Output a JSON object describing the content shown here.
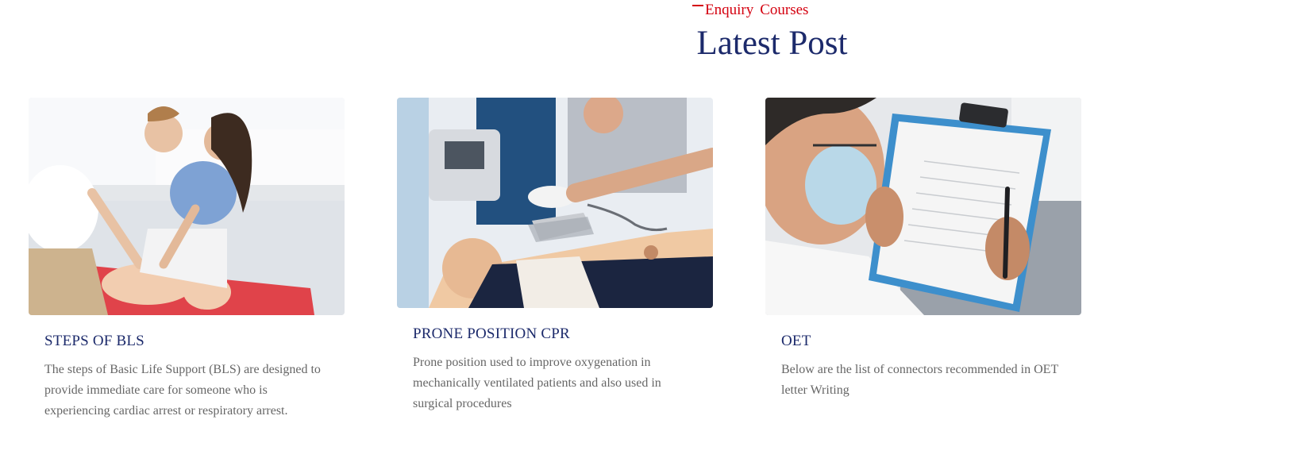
{
  "header": {
    "enquiry_label": "Enquiry",
    "courses_label": "Courses"
  },
  "section": {
    "title": "Latest Post"
  },
  "posts": [
    {
      "image_alt": "Two women practicing chest compressions on a CPR mannequin",
      "title": "STEPS OF BLS",
      "excerpt": "The steps of Basic Life Support (BLS) are designed to provide immediate care for someone who is experiencing cardiac arrest or respiratory arrest."
    },
    {
      "image_alt": "Gloved hand placing defibrillator pad on a mannequin chest",
      "title": "PRONE POSITION CPR",
      "excerpt": "Prone position used to improve oxygenation in mechanically ventilated patients and also used in surgical procedures"
    },
    {
      "image_alt": "Masked doctor writing on a clipboard",
      "title": "OET",
      "excerpt": "Below are the list of connectors recommended in OET letter Writing"
    }
  ],
  "colors": {
    "accent_red": "#d4000f",
    "heading_navy": "#1c2a6b",
    "body_gray": "#666666"
  }
}
